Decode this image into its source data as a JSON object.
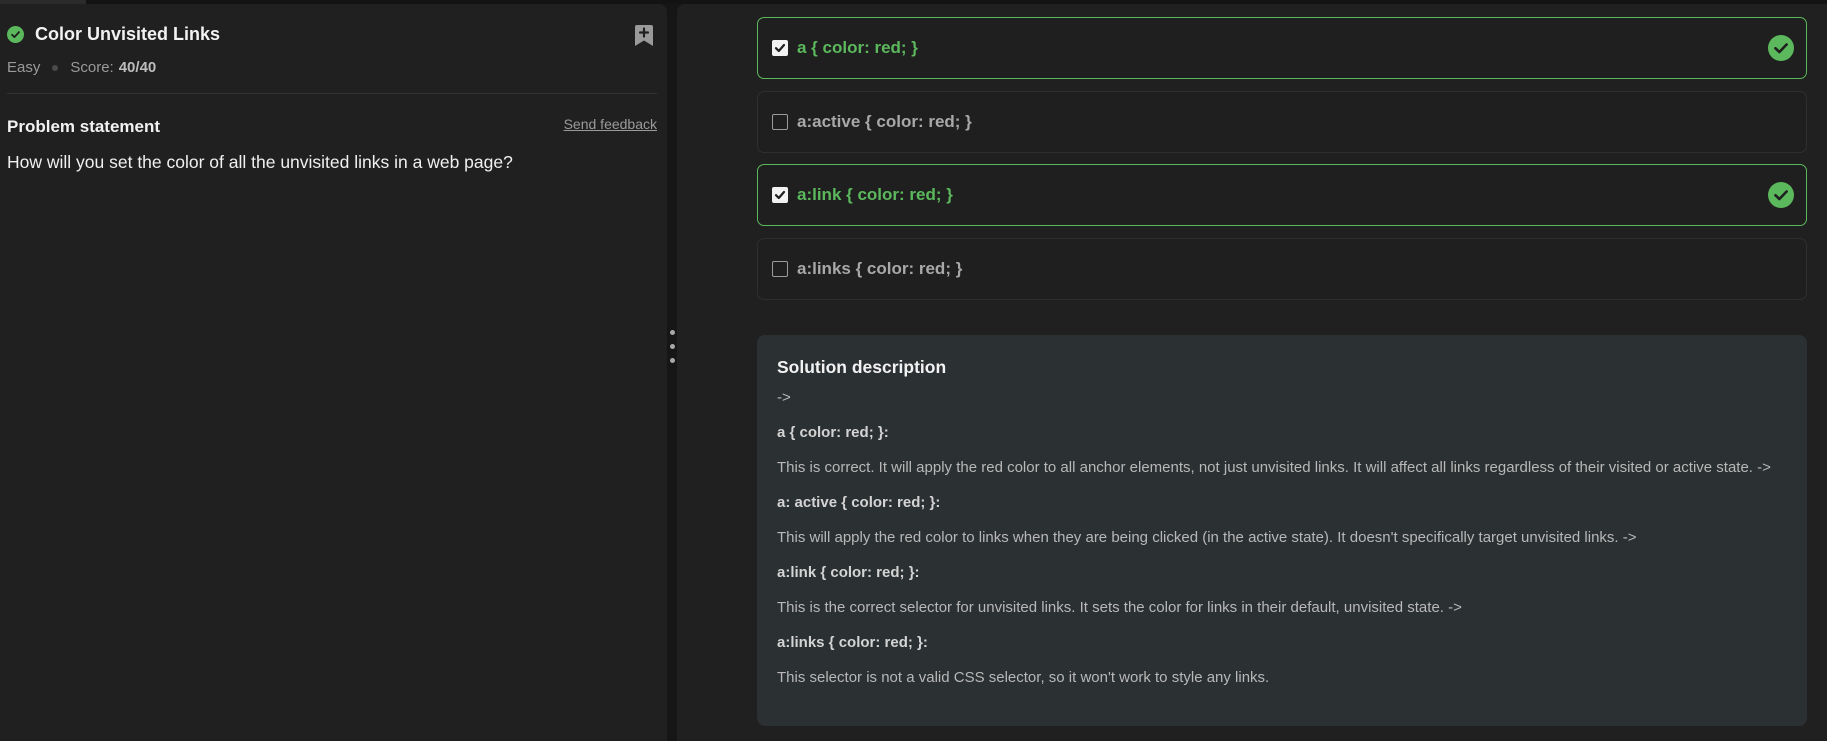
{
  "problem": {
    "title": "Color Unvisited Links",
    "difficulty": "Easy",
    "score_label": "Score:",
    "score_value": "40/40",
    "statement_heading": "Problem statement",
    "feedback_link": "Send feedback",
    "statement": "How will you set the color of all the unvisited links in a web page?"
  },
  "options": [
    {
      "label": "a { color: red; }",
      "checked": true,
      "correct": true
    },
    {
      "label": "a:active { color: red; }",
      "checked": false,
      "correct": false
    },
    {
      "label": "a:link { color: red; }",
      "checked": true,
      "correct": true
    },
    {
      "label": "a:links { color: red; }",
      "checked": false,
      "correct": false
    }
  ],
  "solution": {
    "title": "Solution description",
    "lines": [
      "->",
      "a { color: red; }:",
      "This is correct. It will apply the red color to all anchor elements, not just unvisited links. It will affect all links regardless of their visited or active state. ->",
      "a: active { color: red; }:",
      "This will apply the red color to links when they are being clicked (in the active state). It doesn't specifically target unvisited links. ->",
      "a:link { color: red; }:",
      "This is the correct selector for unvisited links. It sets the color for links in their default, unvisited state. ->",
      "a:links { color: red; }:",
      "This selector is not a valid CSS selector, so it won't work to style any links."
    ]
  },
  "colors": {
    "accent_green": "#5cb85c",
    "panel_bg": "#202020",
    "solution_bg": "#2b3032"
  },
  "icons": [
    "check-circle-icon",
    "bookmark-add-icon",
    "checkbox-checked-icon",
    "checkbox-empty-icon",
    "drag-handle-icon"
  ]
}
